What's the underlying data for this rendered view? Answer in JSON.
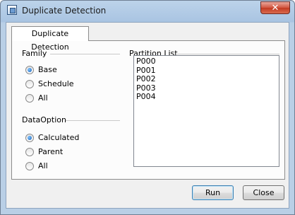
{
  "window": {
    "title": "Duplicate Detection",
    "close_label": "✕"
  },
  "tab": {
    "label": "Duplicate Detection"
  },
  "family": {
    "label": "Family",
    "options": [
      {
        "label": "Base",
        "selected": true
      },
      {
        "label": "Schedule",
        "selected": false
      },
      {
        "label": "All",
        "selected": false
      }
    ]
  },
  "data_option": {
    "label": "DataOption",
    "options": [
      {
        "label": "Calculated",
        "selected": true
      },
      {
        "label": "Parent",
        "selected": false
      },
      {
        "label": "All",
        "selected": false
      }
    ]
  },
  "partition_list": {
    "label": "Partition List",
    "items": [
      "P000",
      "P001",
      "P002",
      "P003",
      "P004"
    ]
  },
  "buttons": {
    "run": "Run",
    "close": "Close"
  }
}
